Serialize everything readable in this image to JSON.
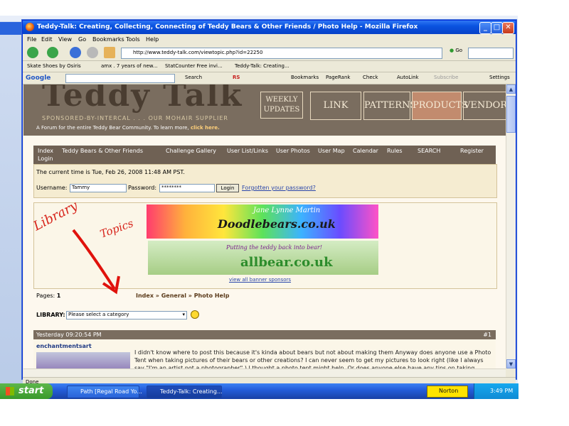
{
  "window": {
    "title": "Teddy-Talk: Creating, Collecting, Connecting of Teddy Bears & Other Friends / Photo Help - Mozilla Firefox",
    "minimize": "_",
    "maximize": "□",
    "close": "✕"
  },
  "menu": [
    "File",
    "Edit",
    "View",
    "Go",
    "Bookmarks",
    "Tools",
    "Help"
  ],
  "address": {
    "url": "http://www.teddy-talk.com/viewtopic.php?id=22250",
    "go_label": "Go"
  },
  "bookmarks": [
    "Skate Shoes by Osiris",
    "amx . 7 years of new...",
    "StatCounter Free invi...",
    "Teddy-Talk: Creating..."
  ],
  "google_toolbar": {
    "logo": "Google",
    "items": [
      "Search",
      "RS",
      "Bookmarks",
      "PageRank",
      "Check",
      "AutoLink",
      "Subscribe",
      "Settings"
    ]
  },
  "site": {
    "logo": "Teddy Talk",
    "sponsor": "SPONSORED-BY-INTERCAL . . . OUR MOHAIR SUPPLIER",
    "tagline": "A Forum for the entire Teddy Bear Community. To learn more,",
    "tagline_link": "click here.",
    "header_buttons": [
      "WEEKLY UPDATES",
      "LINK",
      "PATTERNS",
      "PRODUCTS",
      "VENDORS"
    ]
  },
  "nav": {
    "items": [
      "Index",
      "Teddy Bears & Other Friends",
      "Challenge Gallery",
      "User List/Links",
      "User Photos",
      "User Map",
      "Calendar",
      "Rules",
      "SEARCH",
      "Register"
    ],
    "login": "Login"
  },
  "info": {
    "time": "The current time is Tue, Feb 26, 2008 11:48 AM PST.",
    "username_label": "Username:",
    "username_value": "Tammy",
    "password_label": "Password:",
    "password_value": "********",
    "login_button": "Login",
    "forgot": "Forgotten your password?"
  },
  "banners": {
    "b1_name": "Jane Lynne Martin",
    "b1_site": "Doodlebears.co.uk",
    "b2_tag": "Putting the teddy back into bear!",
    "b2_site": "allbear.co.uk",
    "view_all": "view all banner sponsors"
  },
  "annotation": {
    "word1": "Library",
    "word2": "Topics"
  },
  "pages": {
    "label": "Pages:",
    "value": "1"
  },
  "breadcrumb": {
    "index": "Index",
    "general": "General",
    "current": "Photo Help"
  },
  "library": {
    "label": "LIBRARY:",
    "select": "Please select a category"
  },
  "post": {
    "time": "Yesterday 09:20:54 PM",
    "number": "#1",
    "author": "enchantmentsart",
    "text": "I didn't know where to post this because it's kinda about bears but not about making them  Anyway does anyone use a Photo Tent when taking pictures of their bears or other creations?  I can never seem to get my pictures to look right (like I always say \"I'm an artist not a photographer\" ) I thought a photo tent might help.  Or does anyone else have any tips on taking pictures?  I've tried inside & outside, different color backgrounds and setting & nothing seems to help."
  },
  "status": {
    "text": "Done"
  },
  "taskbar": {
    "start": "start",
    "tasks": [
      "Path [Regal Road Yo...",
      "Teddy-Talk: Creating..."
    ],
    "norton": "Norton",
    "clock": "3:49 PM"
  }
}
